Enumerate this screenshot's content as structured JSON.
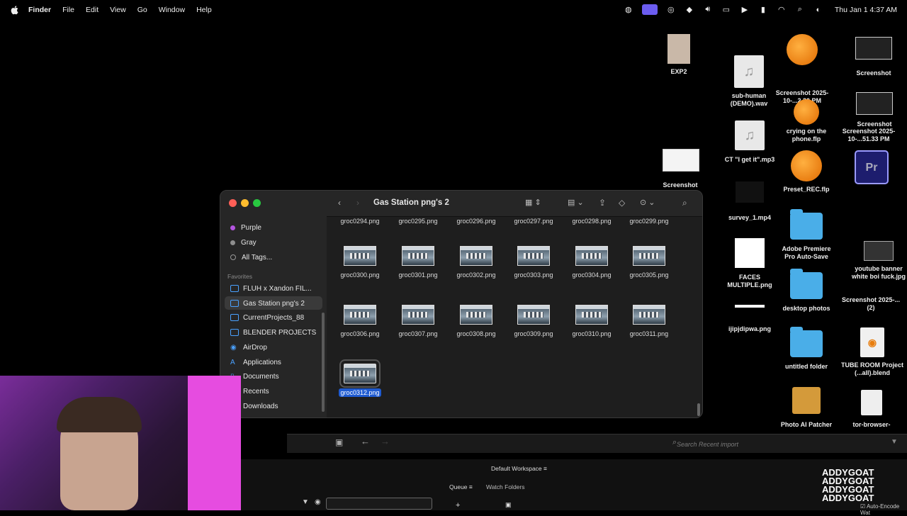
{
  "menubar": {
    "app": "Finder",
    "items": [
      "File",
      "Edit",
      "View",
      "Go",
      "Window",
      "Help"
    ],
    "clock": "Thu Jan 1  4:37 AM"
  },
  "desktop": {
    "icons": [
      {
        "label": "EXP2"
      },
      {
        "label": "sub-human (DEMO).wav"
      },
      {
        "label": "Screenshot 2025-10-...2.30 PM"
      },
      {
        "label": "Screenshot"
      },
      {
        "label": "crying on the phone.flp"
      },
      {
        "label": "CT \"I get it\".mp3"
      },
      {
        "label": "Screenshot"
      },
      {
        "label": "Preset_REC.flp"
      },
      {
        "label": "survey_1.mp4"
      },
      {
        "label": "Adobe Premiere Pro Auto-Save"
      },
      {
        "label": "FACES MULTIPLE.png"
      },
      {
        "label": "desktop photos"
      },
      {
        "label": "ijipjdipwa.png"
      },
      {
        "label": "untitled folder"
      },
      {
        "label": "Photo AI Patcher"
      },
      {
        "label": "Screenshot"
      },
      {
        "label": "Screenshot 2025-10-...51.33 PM"
      },
      {
        "label": "youtube banner white boi fuck.jpg"
      },
      {
        "label": "Screenshot 2025-...(2)"
      },
      {
        "label": "TUBE ROOM Project (...all).blend"
      },
      {
        "label": "tor-browser-"
      }
    ]
  },
  "finder": {
    "title": "Gas Station png's 2",
    "sidebar": {
      "tags": [
        {
          "label": "Purple",
          "color": "#b455e0"
        },
        {
          "label": "Gray",
          "color": "#8e8e8e"
        },
        {
          "label": "All Tags..."
        }
      ],
      "favorites_header": "Favorites",
      "favorites": [
        "FLUH x Xandon FIL...",
        "Gas Station png's 2",
        "CurrentProjects_88",
        "BLENDER PROJECTS",
        "AirDrop",
        "Applications",
        "Documents",
        "Recents",
        "Downloads"
      ]
    },
    "files_row0": [
      "groc0294.png",
      "groc0295.png",
      "groc0296.png",
      "groc0297.png",
      "groc0298.png",
      "groc0299.png"
    ],
    "files_row1": [
      "groc0300.png",
      "groc0301.png",
      "groc0302.png",
      "groc0303.png",
      "groc0304.png",
      "groc0305.png"
    ],
    "files_row2": [
      "groc0306.png",
      "groc0307.png",
      "groc0308.png",
      "groc0309.png",
      "groc0310.png",
      "groc0311.png"
    ],
    "files_row3": [
      "groc0312.png"
    ],
    "selected": "groc0312.png"
  },
  "media_encoder": {
    "search_placeholder": "Search Recent import",
    "workspace": "Default Workspace",
    "tabs": [
      "Queue",
      "Watch Folders"
    ],
    "watermark": [
      "ADDYGOAT",
      "ADDYGOAT",
      "ADDYGOAT",
      "ADDYGOAT"
    ],
    "auto_encode": "Auto-Encode Wat"
  }
}
